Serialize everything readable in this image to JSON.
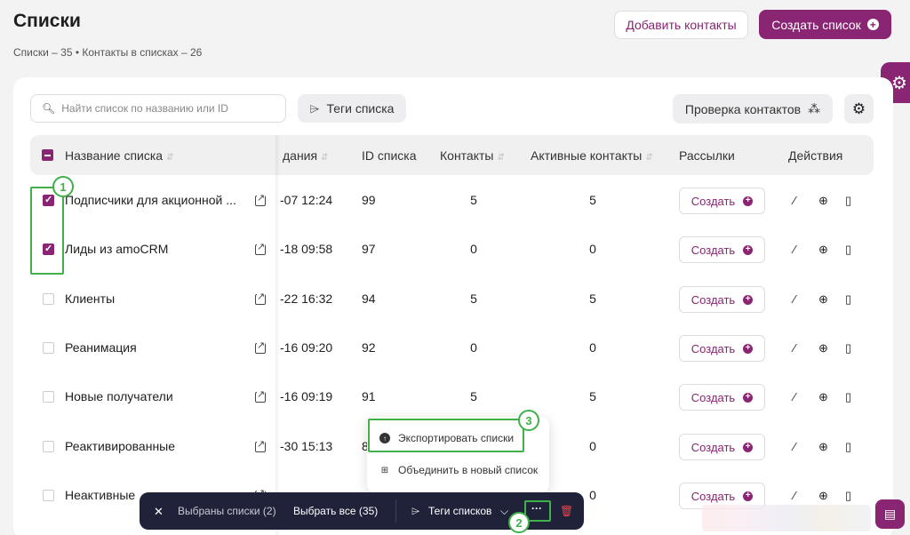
{
  "header": {
    "title": "Списки",
    "subtitle": "Списки – 35 • Контакты в списках – 26",
    "add_contacts": "Добавить контакты",
    "create_list": "Создать список"
  },
  "toolbar": {
    "search_placeholder": "Найти список по названию или ID",
    "tags_label": "Теги списка",
    "check_contacts": "Проверка контактов"
  },
  "table": {
    "headers": {
      "name": "Название списка",
      "date": "дания",
      "id": "ID списка",
      "contacts": "Контакты",
      "active": "Активные контакты",
      "mailings": "Рассылки",
      "actions": "Действия"
    },
    "create_label": "Создать",
    "rows": [
      {
        "name": "Подписчики для акционной ...",
        "date": "-07 12:24",
        "id": "99",
        "contacts": "5",
        "active": "5",
        "checked": true
      },
      {
        "name": "Лиды из amoCRM",
        "date": "-18 09:58",
        "id": "97",
        "contacts": "0",
        "active": "0",
        "checked": true
      },
      {
        "name": "Клиенты",
        "date": "-22 16:32",
        "id": "94",
        "contacts": "5",
        "active": "5",
        "checked": false
      },
      {
        "name": "Реанимация",
        "date": "-16 09:20",
        "id": "92",
        "contacts": "0",
        "active": "0",
        "checked": false
      },
      {
        "name": "Новые получатели",
        "date": "-16 09:19",
        "id": "91",
        "contacts": "5",
        "active": "5",
        "checked": false
      },
      {
        "name": "Реактивированные",
        "date": "-30 15:13",
        "id": "8",
        "contacts": "",
        "active": "0",
        "checked": false
      },
      {
        "name": "Неактивные",
        "date": "",
        "id": "",
        "contacts": "",
        "active": "0",
        "checked": false
      }
    ]
  },
  "menu": {
    "export": "Экспортировать списки",
    "merge": "Объединить в новый список"
  },
  "bottom_bar": {
    "selected": "Выбраны списки (2)",
    "select_all": "Выбрать все (35)",
    "tags": "Теги списков",
    "more": "···"
  },
  "badges": [
    "1",
    "2",
    "3"
  ],
  "colors": {
    "accent": "#8a2573",
    "highlight": "#3fb04a",
    "bar": "#1f2238"
  }
}
